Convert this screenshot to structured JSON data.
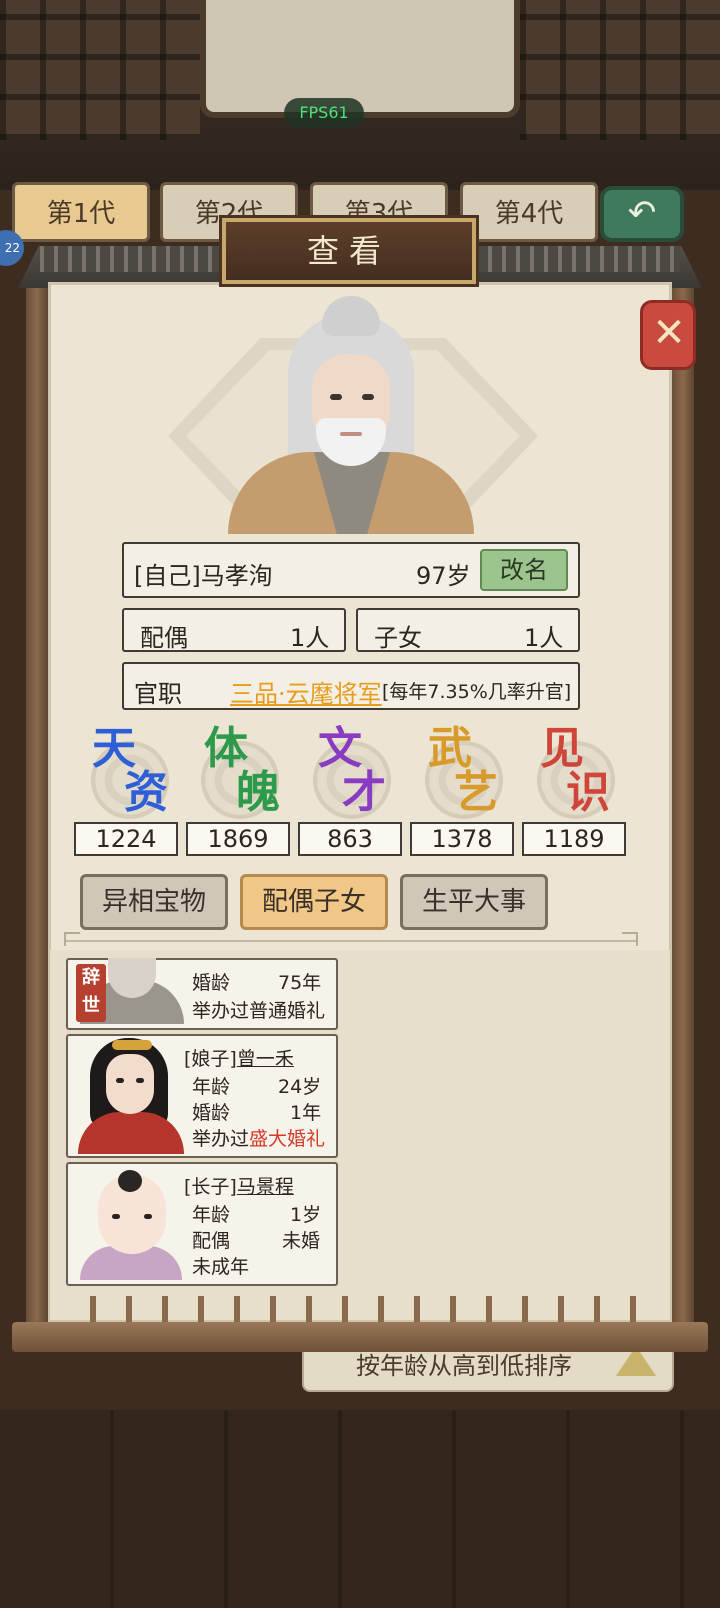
{
  "fps": "FPS61",
  "generation_tabs": [
    "第1代",
    "第2代",
    "第3代",
    "第4代"
  ],
  "side_badge": "22",
  "sort_label": "按年龄从高到低排序",
  "dialog": {
    "title": "查看",
    "close_icon": "close-x-icon"
  },
  "person": {
    "name": "[自己]马孝洵",
    "age": "97岁",
    "rename_label": "改名",
    "spouse_label": "配偶",
    "spouse_count": "1人",
    "children_label": "子女",
    "children_count": "1人",
    "office_label": "官职",
    "office_rank": "三品·云麾将军",
    "office_note": "[每年7.35%几率升官]"
  },
  "attributes": [
    {
      "chars": [
        "天",
        "资"
      ],
      "value": "1224",
      "color": "#2f5fd6"
    },
    {
      "chars": [
        "体",
        "魄"
      ],
      "value": "1869",
      "color": "#2c9a4a"
    },
    {
      "chars": [
        "文",
        "才"
      ],
      "value": "863",
      "color": "#8a3cc0"
    },
    {
      "chars": [
        "武",
        "艺"
      ],
      "value": "1378",
      "color": "#d89a2a"
    },
    {
      "chars": [
        "见",
        "识"
      ],
      "value": "1189",
      "color": "#d0453a"
    }
  ],
  "tabs": [
    "异相宝物",
    "配偶子女",
    "生平大事"
  ],
  "family": {
    "deceased": {
      "stamp": [
        "辞",
        "世"
      ],
      "marriage_label": "婚龄",
      "marriage_value": "75年",
      "wedding_prefix": "举办过",
      "wedding_type": "普通婚礼"
    },
    "wife": {
      "role": "[娘子]",
      "name": "曾一禾",
      "age_label": "年龄",
      "age_value": "24岁",
      "marriage_label": "婚龄",
      "marriage_value": "1年",
      "wedding_prefix": "举办过",
      "wedding_type": "盛大婚礼"
    },
    "son": {
      "role": "[长子]",
      "name": "马景程",
      "age_label": "年龄",
      "age_value": "1岁",
      "spouse_label": "配偶",
      "spouse_value": "未婚",
      "status": "未成年"
    }
  }
}
